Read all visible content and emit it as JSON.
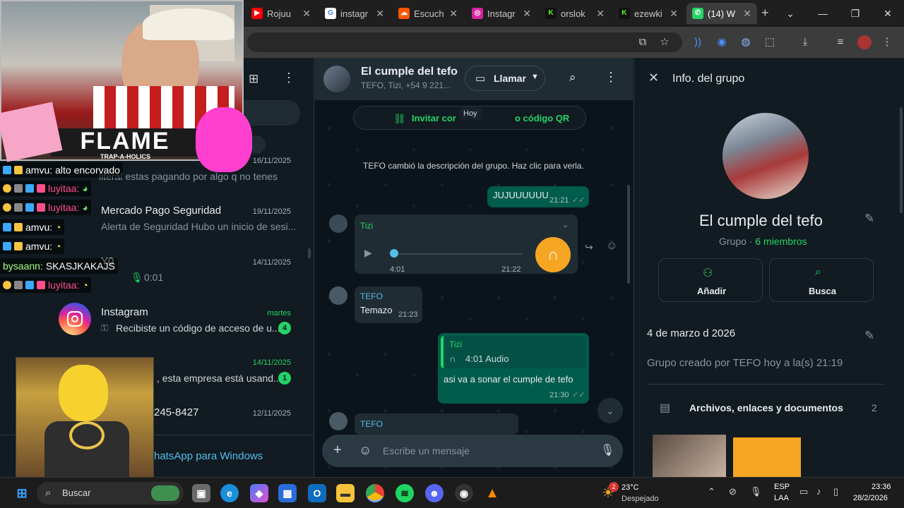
{
  "browser": {
    "tabs": [
      {
        "label": "Rojuu",
        "color": "#ff0000",
        "glyph": "▶"
      },
      {
        "label": "instagr",
        "color": "#4285f4",
        "glyph": "G"
      },
      {
        "label": "Escuch",
        "color": "#ff5500",
        "glyph": "☁"
      },
      {
        "label": "Instagr",
        "color": "#d6249f",
        "glyph": "◎"
      },
      {
        "label": "orslok",
        "color": "#53fc18",
        "glyph": "K"
      },
      {
        "label": "ezewki",
        "color": "#53fc18",
        "glyph": "K"
      },
      {
        "label": "(14) W",
        "color": "#25d366",
        "glyph": "✆"
      }
    ],
    "new_tab": "+",
    "window_controls": [
      "⌄",
      "—",
      "❐",
      "✕"
    ]
  },
  "left": {
    "chats": [
      {
        "name": "",
        "date": "16/11/2025",
        "preview": "literal estas pagando por algo q no tenes"
      },
      {
        "name": "Mercado Pago Seguridad",
        "date": "19/11/2025",
        "preview": "Alerta de Seguridad Hubo un inicio de sesi..."
      },
      {
        "name": "Y0",
        "date": "14/11/2025",
        "preview": "0:01"
      },
      {
        "name": "Instagram",
        "date": "martes",
        "preview": "Recibiste un código de acceso de u...",
        "unread": "4"
      },
      {
        "name": "",
        "date": "14/11/2025",
        "preview": ", esta empresa está usand...",
        "unread": "1"
      },
      {
        "name": "245-8427",
        "date": "12/11/2025",
        "preview": ""
      }
    ],
    "footer": "hatsApp para Windows"
  },
  "chat": {
    "title": "El cumple del tefo",
    "subtitle": "TEFO, Tizi, +54 9 221...",
    "call_label": "Llamar",
    "invite_text": "Invitar cor",
    "invite_text2": "o código QR",
    "date_chip": "Hoy",
    "system_msg": "TEFO cambió la descripción del grupo. Haz clic para verla.",
    "msg1": {
      "text": "JUJUUUUUU",
      "time": "21:21"
    },
    "audio": {
      "sender": "Tizi",
      "duration": "4:01",
      "time": "21:22"
    },
    "msg3": {
      "sender": "TEFO",
      "text": "Temazo",
      "time": "21:23"
    },
    "msg4": {
      "quote_sender": "Tizi",
      "quote_text": "4:01 Audio",
      "text": "asi va a sonar el cumple de tefo",
      "time": "21:30"
    },
    "msg5_sender": "TEFO",
    "composer_placeholder": "Escribe un mensaje"
  },
  "info": {
    "header": "Info. del grupo",
    "group_name": "El cumple del tefo",
    "group_label": "Grupo · ",
    "members": "6 miembros",
    "add_label": "Añadir",
    "search_label": "Busca",
    "description": "4 de marzo d 2026",
    "created": "Grupo creado por TEFO hoy a la(s) 21:19",
    "files_label": "Archivos, enlaces y documentos",
    "files_count": "2"
  },
  "overlay": {
    "logo_text": "FLAME",
    "logo_sub": "TRAP-A-HOLICS",
    "chat": [
      {
        "user": "amvu:",
        "msg": "alto encorvado",
        "color": "#ffffff"
      },
      {
        "user": "luyitaa:",
        "msg": "",
        "color": "#ff4f8b"
      },
      {
        "user": "luyitaa:",
        "msg": "",
        "color": "#ff4f8b"
      },
      {
        "user": "amvu:",
        "msg": "",
        "color": "#ffffff"
      },
      {
        "user": "amvu:",
        "msg": "",
        "color": "#ffffff"
      },
      {
        "user": "bysaann:",
        "msg": "SKASJKAKAJS",
        "color": "#a7ff83"
      },
      {
        "user": "luyitaa:",
        "msg": "",
        "color": "#ff4f8b"
      }
    ]
  },
  "taskbar": {
    "search_label": "Buscar",
    "weather_temp": "23°C",
    "weather_desc": "Despejado",
    "weather_badge": "2",
    "lang": "ESP",
    "lang2": "LAA",
    "time": "23:36",
    "date": "28/2/2026"
  }
}
